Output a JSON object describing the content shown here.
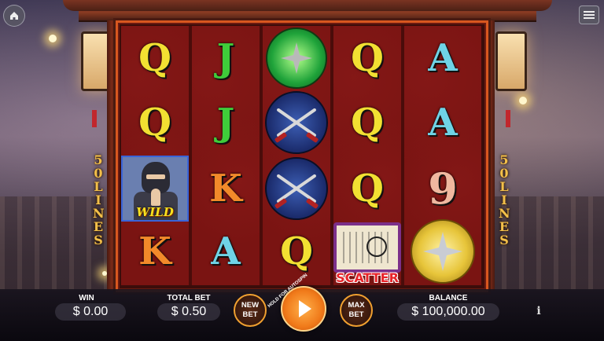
{
  "topbar": {
    "home_icon": "home-icon",
    "menu_icon": "hamburger-menu-icon"
  },
  "paylines": {
    "left_label": "50 LINES",
    "right_label": "50 LINES"
  },
  "reels": [
    [
      "Q",
      "Q",
      "WILD",
      "K"
    ],
    [
      "J",
      "J",
      "K",
      "A"
    ],
    [
      "green-shuriken",
      "crossed-swords",
      "crossed-swords",
      "Q"
    ],
    [
      "Q",
      "Q",
      "Q",
      "SCATTER"
    ],
    [
      "A",
      "A",
      "9",
      "gold-shuriken"
    ]
  ],
  "symbols": {
    "wild_label": "WILD",
    "scatter_label": "SCATTER"
  },
  "bottom": {
    "win_label": "WIN",
    "win_value": "$ 0.00",
    "total_bet_label": "TOTAL BET",
    "total_bet_value": "$ 0.50",
    "new_bet_label": "NEW BET",
    "spin_hint": "HOLD FOR AUTOSPIN",
    "max_bet_label": "MAX BET",
    "balance_label": "BALANCE",
    "balance_value": "$ 100,000.00",
    "info_label": "i"
  },
  "colors": {
    "frame_border": "#d8571f",
    "reel_bg": "#7a1412",
    "spin_button": "#f07a1a",
    "bet_button_ring": "#f0a030"
  }
}
